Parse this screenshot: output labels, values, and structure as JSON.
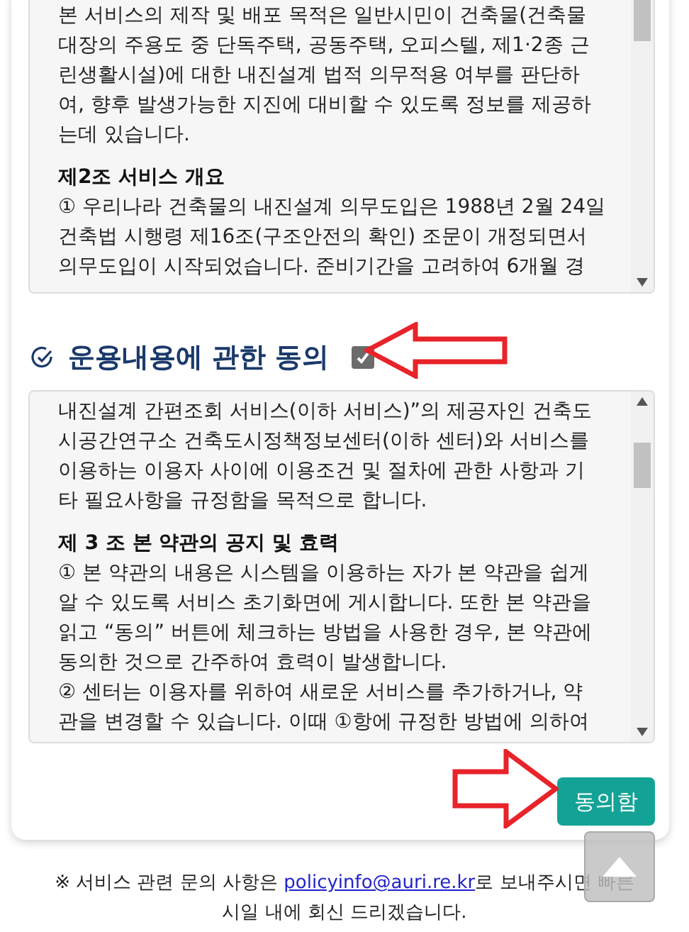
{
  "terms_box_1": {
    "blocks": [
      {
        "kind": "line",
        "text": "본 서비스의 제작 및 배포 목적은 일반시민이 건축물(건축물"
      },
      {
        "kind": "line",
        "text": "대장의 주용도 중 단독주택, 공동주택, 오피스텔, 제1·2종 근"
      },
      {
        "kind": "line",
        "text": "린생활시설)에 대한 내진설계 법적 의무적용 여부를 판단하"
      },
      {
        "kind": "line",
        "text": "여, 향후 발생가능한 지진에 대비할 수 있도록 정보를 제공하"
      },
      {
        "kind": "line",
        "text": "는데 있습니다."
      },
      {
        "kind": "heading",
        "text": "제2조 서비스 개요"
      },
      {
        "kind": "line",
        "text": "① 우리나라 건축물의 내진설계 의무도입은 1988년 2월 24일"
      },
      {
        "kind": "line",
        "text": "건축법 시행령 제16조(구조안전의 확인) 조문이 개정되면서"
      },
      {
        "kind": "line",
        "text": "의무도입이 시작되었습니다. 준비기간을 고려하여 6개월 경"
      }
    ]
  },
  "section": {
    "title": "운용내용에 관한 동의",
    "checked": true
  },
  "terms_box_2": {
    "blocks": [
      {
        "kind": "line",
        "text": "내진설계 간편조회 서비스(이하 서비스)”의 제공자인 건축도"
      },
      {
        "kind": "line",
        "text": "시공간연구소 건축도시정책정보센터(이하 센터)와 서비스를"
      },
      {
        "kind": "line",
        "text": "이용하는 이용자 사이에 이용조건 및 절차에 관한 사항과 기"
      },
      {
        "kind": "line",
        "text": "타 필요사항을 규정함을 목적으로 합니다."
      },
      {
        "kind": "heading",
        "text": "제 3 조 본 약관의 공지 및 효력"
      },
      {
        "kind": "line",
        "text": "① 본 약관의 내용은 시스템을 이용하는 자가 본 약관을 쉽게"
      },
      {
        "kind": "line",
        "text": "알 수 있도록 서비스 초기화면에 게시합니다. 또한 본 약관을"
      },
      {
        "kind": "line",
        "text": "읽고 “동의” 버튼에 체크하는 방법을 사용한 경우, 본 약관에"
      },
      {
        "kind": "line",
        "text": "동의한 것으로 간주하여 효력이 발생합니다."
      },
      {
        "kind": "line",
        "text": "② 센터는 이용자를 위하여 새로운 서비스를 추가하거나, 약"
      },
      {
        "kind": "line",
        "text": "관을 변경할 수 있습니다. 이때 ①항에 규정한 방법에 의하여"
      }
    ]
  },
  "agree_button": "동의함",
  "footer": {
    "before": "※ 서비스 관련 문의 사항은 ",
    "email": "policyinfo@auri.re.kr",
    "after": "로 보내주시면 빠른",
    "line_2": "시일 내에 회신 드리겠습니다."
  }
}
